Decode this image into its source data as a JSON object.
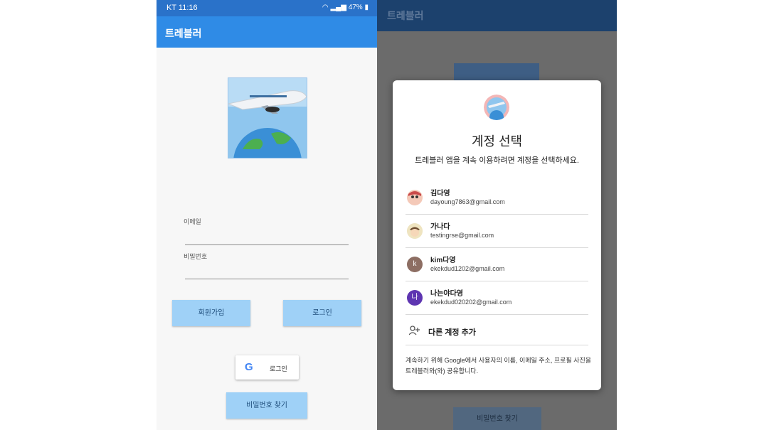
{
  "left_screen": {
    "status_bar": {
      "left": "KT 11:16",
      "right": "47%"
    },
    "app_title": "트레블러",
    "email_label": "이메일",
    "password_label": "비밀번호",
    "signup_button": "회원가입",
    "login_button": "로그인",
    "google_login_button": "로그인",
    "find_password_button": "비밀번호 찾기"
  },
  "right_screen": {
    "app_title": "트레블러",
    "background_button": "비밀번호 찾기",
    "dialog": {
      "title": "계정 선택",
      "subtitle": "트레블러 앱을 계속 이용하려면 계정을 선택하세요.",
      "accounts": [
        {
          "name": "김다영",
          "email": "dayoung7863@gmail.com",
          "avatar": "photo-cartoon"
        },
        {
          "name": "가나다",
          "email": "testingrse@gmail.com",
          "avatar": "photo-cartoon"
        },
        {
          "name": "kim다영",
          "email": "ekekdud1202@gmail.com",
          "avatar_letter": "k",
          "avatar_color": "#8d6e63"
        },
        {
          "name": "나는야다영",
          "email": "ekekdud020202@gmail.com",
          "avatar_letter": "나",
          "avatar_color": "#5e35b1"
        }
      ],
      "add_account": "다른 계정 추가",
      "footer": "계속하기 위해 Google에서 사용자의 이름, 이메일 주소, 프로필 사진을 트레블러와(와) 공유합니다."
    }
  },
  "colors": {
    "status_bar": "#2a72c9",
    "app_bar": "#2f8be6",
    "button_bg": "#9fd1f7",
    "overlay": "#6b6b6b"
  }
}
